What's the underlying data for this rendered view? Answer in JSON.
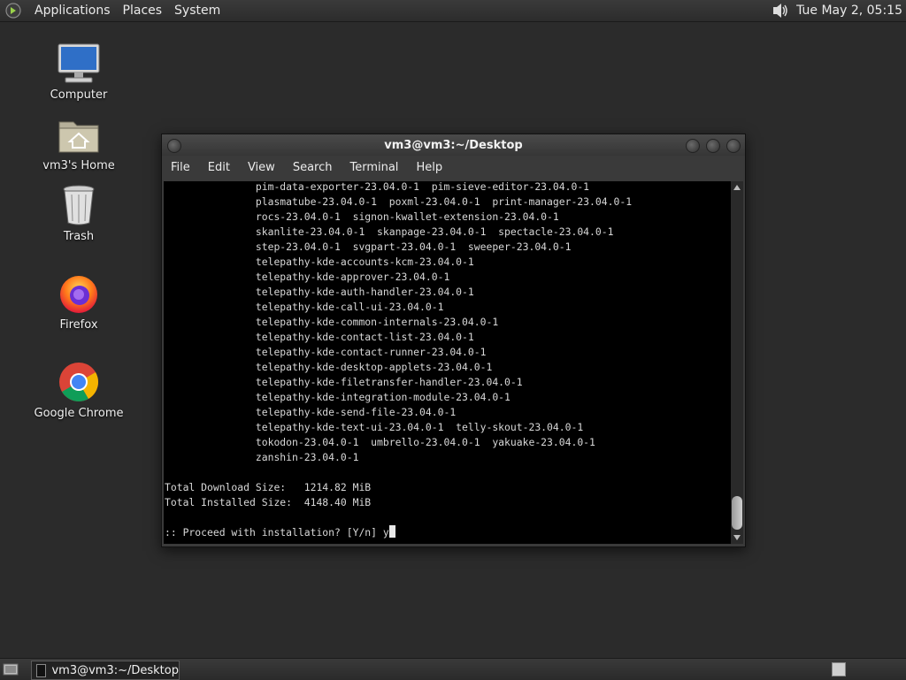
{
  "top_panel": {
    "menus": [
      "Applications",
      "Places",
      "System"
    ],
    "clock": "Tue May  2, 05:15"
  },
  "desktop_icons": [
    {
      "label": "Computer",
      "icon": "computer-icon"
    },
    {
      "label": "vm3's Home",
      "icon": "home-folder-icon"
    },
    {
      "label": "Trash",
      "icon": "trash-icon"
    },
    {
      "label": "Firefox",
      "icon": "firefox-icon"
    },
    {
      "label": "Google Chrome",
      "icon": "chrome-icon"
    }
  ],
  "window": {
    "title": "vm3@vm3:~/Desktop",
    "menus": [
      "File",
      "Edit",
      "View",
      "Search",
      "Terminal",
      "Help"
    ]
  },
  "terminal": {
    "lines": [
      "               pim-data-exporter-23.04.0-1  pim-sieve-editor-23.04.0-1",
      "               plasmatube-23.04.0-1  poxml-23.04.0-1  print-manager-23.04.0-1",
      "               rocs-23.04.0-1  signon-kwallet-extension-23.04.0-1",
      "               skanlite-23.04.0-1  skanpage-23.04.0-1  spectacle-23.04.0-1",
      "               step-23.04.0-1  svgpart-23.04.0-1  sweeper-23.04.0-1",
      "               telepathy-kde-accounts-kcm-23.04.0-1",
      "               telepathy-kde-approver-23.04.0-1",
      "               telepathy-kde-auth-handler-23.04.0-1",
      "               telepathy-kde-call-ui-23.04.0-1",
      "               telepathy-kde-common-internals-23.04.0-1",
      "               telepathy-kde-contact-list-23.04.0-1",
      "               telepathy-kde-contact-runner-23.04.0-1",
      "               telepathy-kde-desktop-applets-23.04.0-1",
      "               telepathy-kde-filetransfer-handler-23.04.0-1",
      "               telepathy-kde-integration-module-23.04.0-1",
      "               telepathy-kde-send-file-23.04.0-1",
      "               telepathy-kde-text-ui-23.04.0-1  telly-skout-23.04.0-1",
      "               tokodon-23.04.0-1  umbrello-23.04.0-1  yakuake-23.04.0-1",
      "               zanshin-23.04.0-1",
      "",
      "Total Download Size:   1214.82 MiB",
      "Total Installed Size:  4148.40 MiB",
      ""
    ],
    "prompt": ":: Proceed with installation? [Y/n] y"
  },
  "taskbar": {
    "task_label": "vm3@vm3:~/Desktop"
  }
}
